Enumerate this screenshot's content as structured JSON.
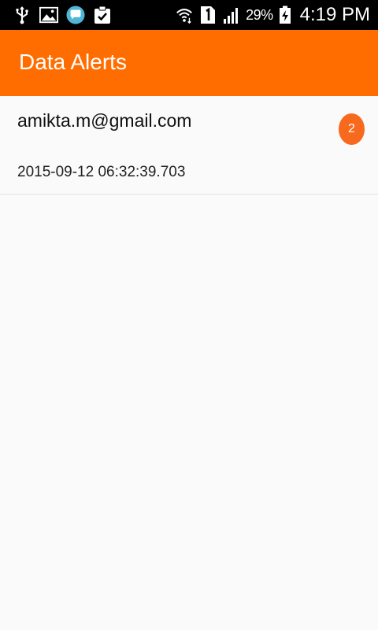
{
  "status_bar": {
    "left_icons": [
      "usb-icon",
      "image-icon",
      "chat-bubble-icon",
      "clipboard-check-icon"
    ],
    "right_icons": [
      "wifi-icon",
      "sim-1-icon",
      "signal-icon",
      "battery-charging-icon"
    ],
    "battery_percent": "29%",
    "time": "4:19 PM"
  },
  "app_bar": {
    "title": "Data Alerts",
    "color": "#ff6d00"
  },
  "alerts": [
    {
      "email": "amikta.m@gmail.com",
      "timestamp": "2015-09-12 06:32:39.703",
      "count": "2",
      "badge_color": "#f7691c"
    }
  ]
}
